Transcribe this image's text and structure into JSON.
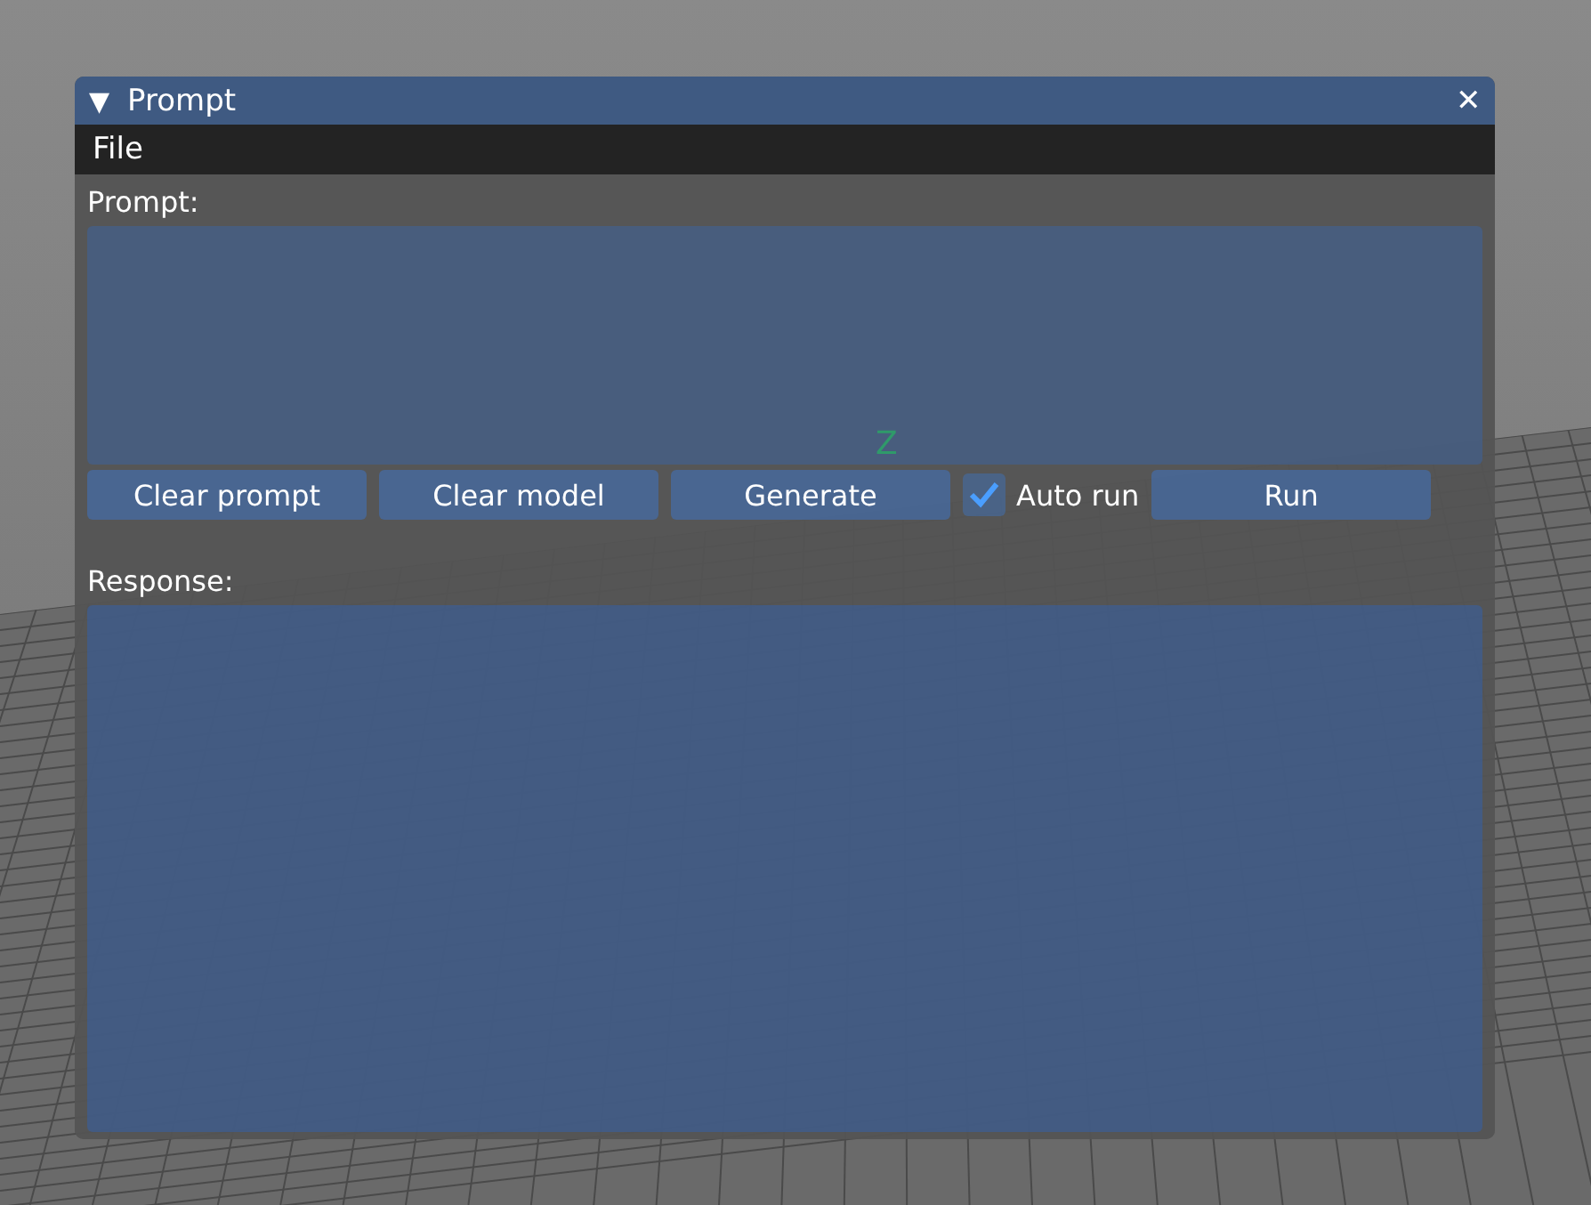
{
  "viewport": {
    "axis_label": "Z"
  },
  "window": {
    "title": "Prompt",
    "collapse_icon": "▼",
    "close_icon": "✕"
  },
  "menu_bar": [
    "File"
  ],
  "prompt": {
    "label": "Prompt:"
  },
  "controls": [
    {
      "kind": "button",
      "label": "Clear prompt"
    },
    {
      "kind": "button",
      "label": "Clear model"
    },
    {
      "kind": "button",
      "label": "Generate"
    },
    {
      "kind": "checkbox",
      "label": "Auto run",
      "checked": true
    },
    {
      "kind": "button",
      "label": "Run"
    }
  ],
  "response": {
    "label": "Response:"
  }
}
